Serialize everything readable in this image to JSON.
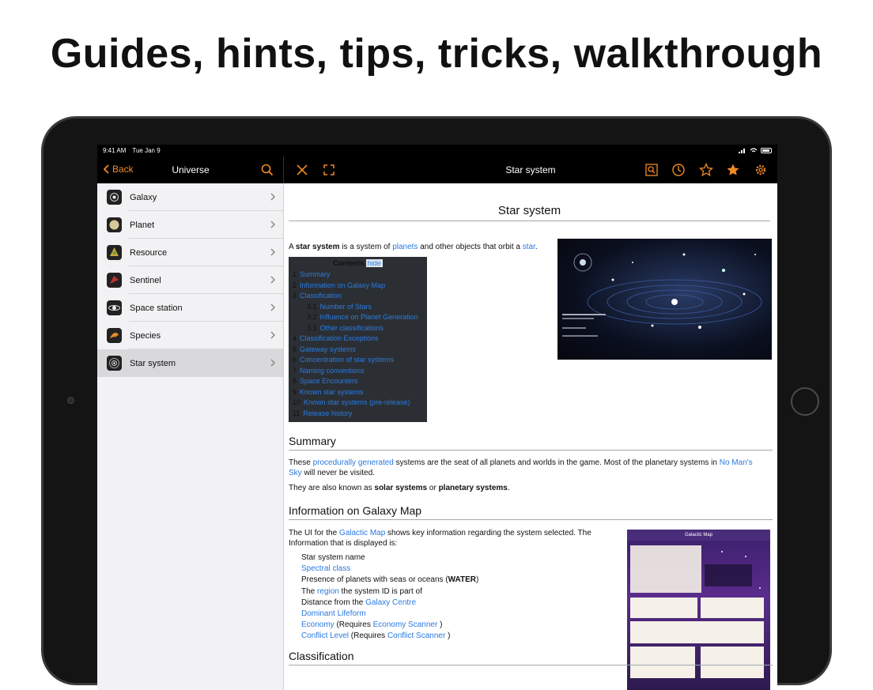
{
  "headline": "Guides, hints, tips, tricks, walkthrough",
  "status": {
    "time": "9:41 AM",
    "date": "Tue Jan 9"
  },
  "nav": {
    "back_label": "Back",
    "left_title": "Universe",
    "right_title": "Star system"
  },
  "sidebar": {
    "items": [
      {
        "label": "Galaxy",
        "icon": "galaxy-icon"
      },
      {
        "label": "Planet",
        "icon": "planet-icon"
      },
      {
        "label": "Resource",
        "icon": "resource-icon"
      },
      {
        "label": "Sentinel",
        "icon": "sentinel-icon"
      },
      {
        "label": "Space station",
        "icon": "space-station-icon"
      },
      {
        "label": "Species",
        "icon": "species-icon"
      },
      {
        "label": "Star system",
        "icon": "star-system-icon",
        "selected": true
      }
    ]
  },
  "article": {
    "title": "Star system",
    "lead": {
      "a": "A ",
      "bold": "star system",
      "b": " is a system of ",
      "link1": "planets",
      "c": " and other objects that orbit a ",
      "link2": "star",
      "d": "."
    },
    "toc": {
      "title": "Contents",
      "hide": "hide",
      "rows": [
        {
          "num": "1",
          "text": "Summary",
          "sub": false
        },
        {
          "num": "2",
          "text": "Information on Galaxy Map",
          "sub": false
        },
        {
          "num": "3",
          "text": "Classification",
          "sub": false
        },
        {
          "num": "3.1",
          "text": "Number of Stars",
          "sub": true
        },
        {
          "num": "3.2",
          "text": "Influence on Planet Generation",
          "sub": true
        },
        {
          "num": "3.3",
          "text": "Other classifications",
          "sub": true
        },
        {
          "num": "4",
          "text": "Classification Exceptions",
          "sub": false
        },
        {
          "num": "5",
          "text": "Gateway systems",
          "sub": false
        },
        {
          "num": "6",
          "text": "Concentration of star systems",
          "sub": false
        },
        {
          "num": "7",
          "text": "Naming conventions",
          "sub": false
        },
        {
          "num": "8",
          "text": "Space Encounters",
          "sub": false
        },
        {
          "num": "9",
          "text": "Known star systems",
          "sub": false
        },
        {
          "num": "10",
          "text": "Known star systems (pre-release)",
          "sub": false
        },
        {
          "num": "11",
          "text": "Release history",
          "sub": false
        }
      ]
    },
    "summary_heading": "Summary",
    "summary_p1": {
      "a": "These ",
      "link1": "procedurally generated",
      "b": " systems are the seat of all planets and worlds in the game. Most of the planetary systems in ",
      "link2": "No Man's Sky",
      "c": " will never be visited."
    },
    "summary_p2": {
      "a": "They are also known as ",
      "bold1": "solar systems",
      "b": " or ",
      "bold2": "planetary systems",
      "c": "."
    },
    "info_heading": "Information on Galaxy Map",
    "info_p": {
      "a": "The UI for the ",
      "link": "Galactic Map",
      "b": " shows key information regarding the system selected. The Information that is displayed is:"
    },
    "info_list": {
      "item1": "Star system name",
      "item2_link": "Spectral class",
      "item3_a": "Presence of planets with seas or oceans (",
      "item3_bold": "WATER",
      "item3_b": ")",
      "item4_a": "The ",
      "item4_link": "region",
      "item4_b": " the system ID is part of",
      "item5_a": "Distance from the ",
      "item5_link": "Galaxy Centre",
      "item6_link": "Dominant Lifeform",
      "item7_link": "Economy",
      "item7_a": " (Requires ",
      "item7_link2": "Economy Scanner",
      "item7_b": " )",
      "item8_link": "Conflict Level",
      "item8_a": " (Requires ",
      "item8_link2": "Conflict Scanner",
      "item8_b": " )"
    },
    "classification_heading": "Classification",
    "map_image_title": "Galactic Map"
  },
  "colors": {
    "accent": "#f08a24",
    "link": "#2a7ae2"
  }
}
